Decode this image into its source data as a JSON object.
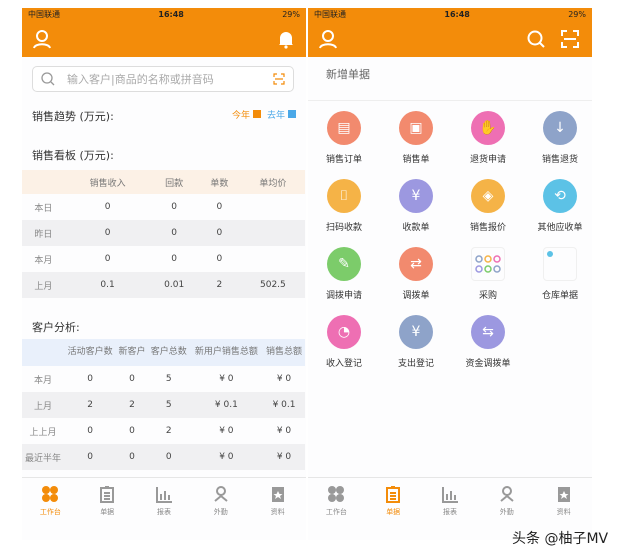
{
  "status": {
    "carrier": "中国联通",
    "time": "16:48",
    "battery": "29%"
  },
  "home": {
    "search_placeholder": "输入客户|商品的名称或拼音码",
    "trend_title": "销售趋势 (万元):",
    "legend": [
      {
        "label": "今年",
        "color": "#f38c0a"
      },
      {
        "label": "去年",
        "color": "#4aa8e8"
      }
    ],
    "board_title": "销售看板 (万元):",
    "board_headers": [
      "",
      "销售收入",
      "回款",
      "单数",
      "单均价"
    ],
    "board_rows": [
      [
        "本日",
        "0",
        "0",
        "0",
        ""
      ],
      [
        "昨日",
        "0",
        "0",
        "0",
        ""
      ],
      [
        "本月",
        "0",
        "0",
        "0",
        ""
      ],
      [
        "上月",
        "0.1",
        "0.01",
        "2",
        "502.5"
      ]
    ],
    "cust_title": "客户分析:",
    "cust_headers": [
      "",
      "活动客户数",
      "新客户",
      "客户总数",
      "新用户销售总额",
      "销售总额"
    ],
    "cust_rows": [
      [
        "本月",
        "0",
        "0",
        "5",
        "¥ 0",
        "¥ 0"
      ],
      [
        "上月",
        "2",
        "2",
        "5",
        "¥ 0.1",
        "¥ 0.1"
      ],
      [
        "上上月",
        "0",
        "0",
        "2",
        "¥ 0",
        "¥ 0"
      ],
      [
        "最近半年",
        "0",
        "0",
        "0",
        "¥ 0",
        "¥ 0"
      ]
    ]
  },
  "docs": {
    "title": "新增单据",
    "items": [
      {
        "label": "销售订单",
        "color": "#f28a6e"
      },
      {
        "label": "销售单",
        "color": "#f28a6e"
      },
      {
        "label": "退货申请",
        "color": "#ee6fb3"
      },
      {
        "label": "销售退货",
        "color": "#8ea3c9"
      },
      {
        "label": "扫码收款",
        "color": "#f5b347"
      },
      {
        "label": "收款单",
        "color": "#9c98e0"
      },
      {
        "label": "销售报价",
        "color": "#f5b347"
      },
      {
        "label": "其他应收单",
        "color": "#5cc2e6"
      },
      {
        "label": "调拨申请",
        "color": "#7ccc6a"
      },
      {
        "label": "调拨单",
        "color": "#f28a6e"
      },
      {
        "label": "采购",
        "color": ""
      },
      {
        "label": "仓库单据",
        "color": ""
      },
      {
        "label": "收入登记",
        "color": "#ee6fb3"
      },
      {
        "label": "支出登记",
        "color": "#8ea3c9"
      },
      {
        "label": "资金调拨单",
        "color": "#9c98e0"
      }
    ]
  },
  "tabs": [
    "工作台",
    "单据",
    "报表",
    "外勤",
    "资料"
  ],
  "watermark": "头条 @柚子MV"
}
